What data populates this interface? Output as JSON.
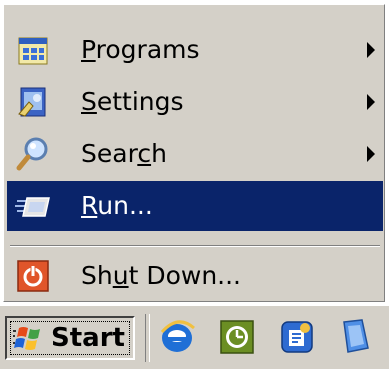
{
  "menu": {
    "items": [
      {
        "pre": "",
        "u": "P",
        "post": "rograms",
        "has_submenu": true
      },
      {
        "pre": "",
        "u": "S",
        "post": "ettings",
        "has_submenu": true
      },
      {
        "pre": "Sear",
        "u": "c",
        "post": "h",
        "has_submenu": true
      },
      {
        "pre": "",
        "u": "R",
        "post": "un...",
        "has_submenu": false,
        "highlighted": true
      },
      {
        "pre": "Sh",
        "u": "u",
        "post": "t Down...",
        "has_submenu": false
      }
    ],
    "icons": [
      "programs-icon",
      "settings-icon",
      "search-icon",
      "run-icon",
      "shut-down-icon"
    ]
  },
  "taskbar": {
    "start_label": "Start",
    "quick_launch": [
      "internet-explorer-icon",
      "green-clock-icon",
      "blue-app-icon",
      "blue-document-icon"
    ]
  },
  "colors": {
    "menu_bg": "#d4d0c8",
    "highlight": "#0a246a"
  }
}
